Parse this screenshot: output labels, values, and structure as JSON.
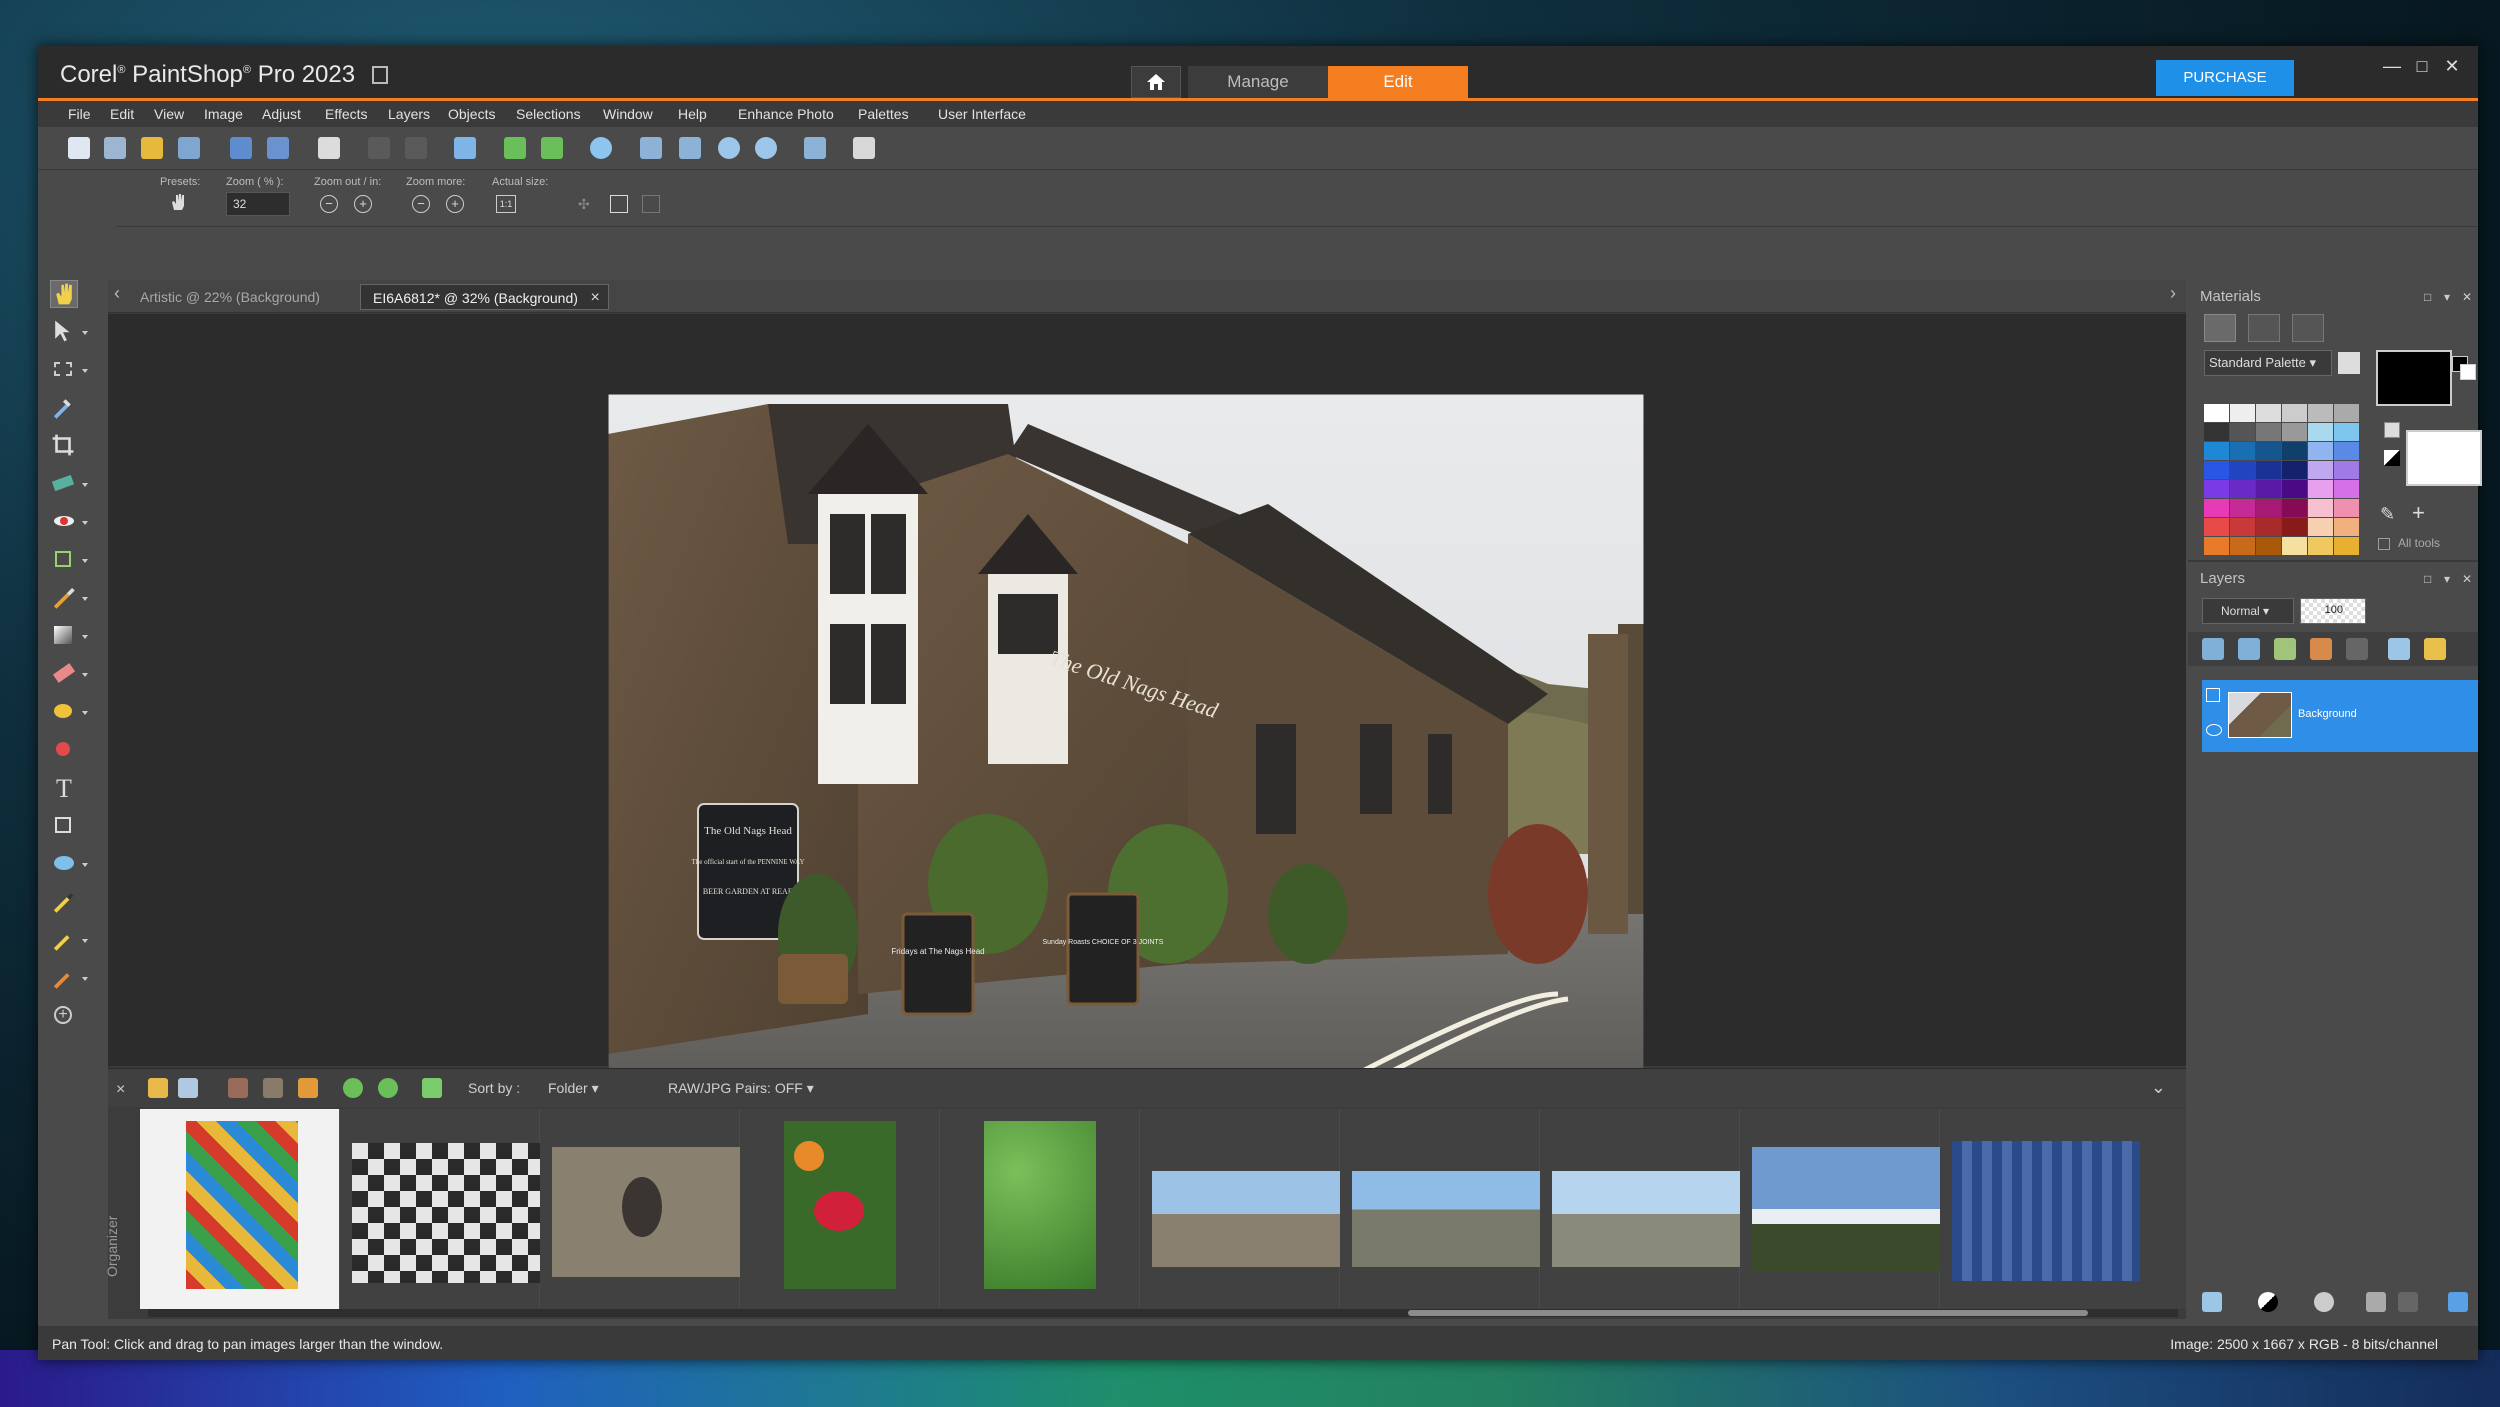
{
  "app": {
    "name": "Corel",
    "reg": "®",
    "product": "PaintShop",
    "reg2": "®",
    "product2": "Pro 2023"
  },
  "nav_tabs": {
    "manage": "Manage",
    "edit": "Edit"
  },
  "purchase_label": "PURCHASE",
  "window_controls": {
    "minimize": "—",
    "maximize": "□",
    "close": "✕"
  },
  "menu": [
    "File",
    "Edit",
    "View",
    "Image",
    "Adjust",
    "Effects",
    "Layers",
    "Objects",
    "Selections",
    "Window",
    "Help",
    "Enhance Photo",
    "Palettes",
    "User Interface"
  ],
  "options": {
    "presets_label": "Presets:",
    "zoom_label": "Zoom ( % ):",
    "zoom_value": "32",
    "zoom_inout_label": "Zoom out / in:",
    "zoom_more_label": "Zoom more:",
    "actual_size_label": "Actual size:",
    "actual_size_icon_text": "1:1"
  },
  "doc_tabs": [
    {
      "label": "Artistic @  22% (Background)"
    },
    {
      "label": "EI6A6812* @  32% (Background)",
      "close": "×"
    }
  ],
  "organizer": {
    "sort_by_label": "Sort by :",
    "sort_value": "Folder",
    "raw_pairs": "RAW/JPG Pairs: OFF",
    "side_label": "Organizer",
    "close": "×"
  },
  "materials": {
    "title": "Materials",
    "palette_select": "Standard Palette",
    "all_tools": "All tools"
  },
  "layers": {
    "title": "Layers",
    "blend_mode": "Normal",
    "opacity": "100",
    "layer_name": "Background"
  },
  "status": {
    "left": "Pan Tool: Click and drag to pan images larger than the window.",
    "right": "Image:  2500 x 1667 x RGB - 8 bits/channel"
  },
  "colors": {
    "accent_orange": "#f57f20",
    "purchase_blue": "#1e90e8",
    "layer_selected": "#2f8fe8",
    "panel_bg": "#4a4a4a"
  },
  "icons": {
    "home": "home-icon",
    "pan": "hand-icon",
    "sign_text_1": "The Old Nags Head",
    "sign_text_2": "The official start of the PENNINE WAY",
    "sign_text_3": "BEER GARDEN AT REAR",
    "pub_sign": "The Old Nags Head",
    "board_1": "Fridays at The Nags Head",
    "board_2": "Sunday Roasts CHOICE OF 3 JOINTS"
  }
}
